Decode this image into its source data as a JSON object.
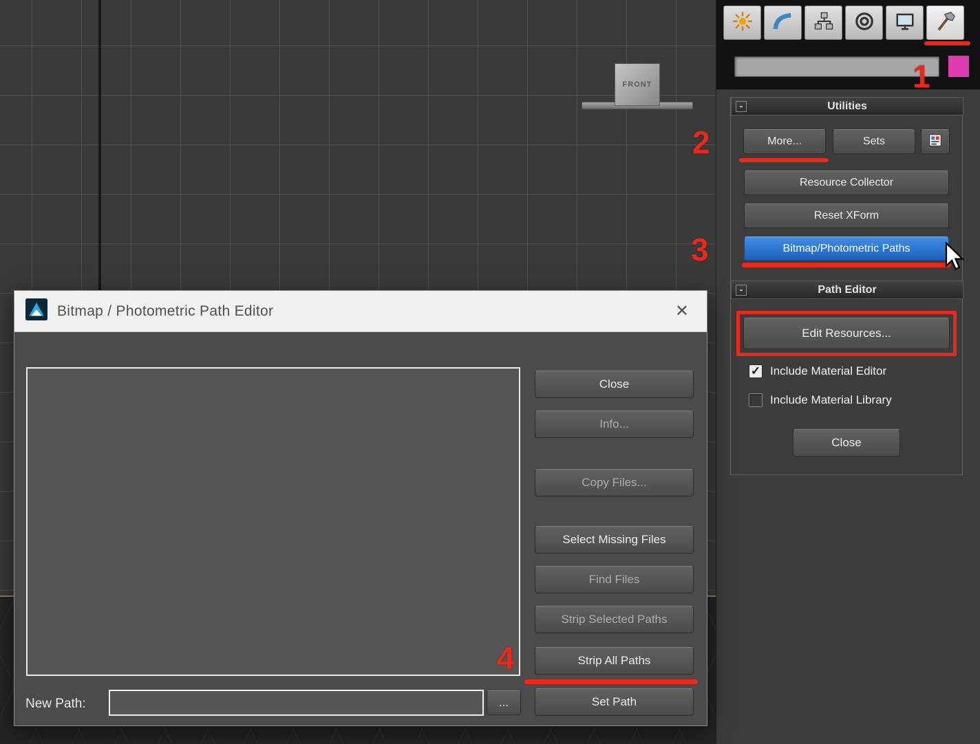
{
  "colors": {
    "annotation_red": "#e8291c",
    "highlight_blue": "#2e7bd6",
    "object_color_swatch": "#df3bb1"
  },
  "viewport": {
    "front_label": "FRONT"
  },
  "command_panel": {
    "tabs": [
      {
        "name": "create"
      },
      {
        "name": "modify"
      },
      {
        "name": "hierarchy"
      },
      {
        "name": "motion"
      },
      {
        "name": "display"
      },
      {
        "name": "utilities",
        "active": true
      }
    ],
    "object_name_value": "",
    "utilities": {
      "collapse_glyph": "-",
      "title": "Utilities",
      "more_button": "More...",
      "sets_button": "Sets",
      "resource_collector_button": "Resource Collector",
      "reset_xform_button": "Reset XForm",
      "bitmap_paths_button": "Bitmap/Photometric Paths"
    },
    "path_editor": {
      "collapse_glyph": "-",
      "title": "Path Editor",
      "edit_resources_button": "Edit Resources...",
      "include_material_editor_label": "Include Material Editor",
      "include_material_editor_checked": true,
      "include_material_library_label": "Include Material Library",
      "include_material_library_checked": false,
      "check_glyph": "✓",
      "close_button": "Close"
    }
  },
  "dialog": {
    "title": "Bitmap / Photometric Path Editor",
    "close_glyph": "✕",
    "list_items": [],
    "buttons": {
      "close": "Close",
      "info": "Info...",
      "copy_files": "Copy Files...",
      "select_missing": "Select Missing Files",
      "find_files": "Find Files",
      "strip_selected": "Strip Selected Paths",
      "strip_all": "Strip All Paths",
      "set_path": "Set Path"
    },
    "new_path_label": "New Path:",
    "new_path_value": "",
    "browse_button": "..."
  },
  "annotations": {
    "step_1": "1",
    "step_2": "2",
    "step_3": "3",
    "step_4": "4"
  }
}
